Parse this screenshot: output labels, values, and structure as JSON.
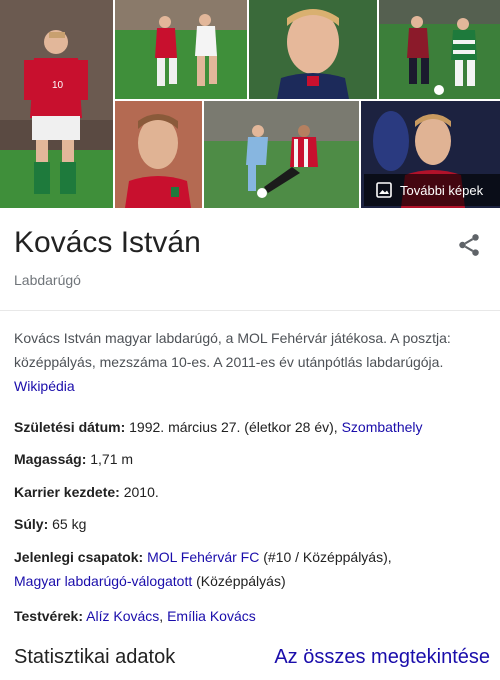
{
  "gallery": {
    "more_images_label": "További képek"
  },
  "header": {
    "title": "Kovács István",
    "subtitle": "Labdarúgó"
  },
  "description": {
    "text": "Kovács István magyar labdarúgó, a MOL Fehérvár játékosa. A posztja: középpályás, mezszáma 10-es. A 2011-es év utánpótlás labdarúgója.",
    "source_link": "Wikipédia"
  },
  "facts": {
    "birth": {
      "label": "Születési dátum:",
      "value": " 1992. március 27. (életkor 28 év), ",
      "place_link": "Szombathely"
    },
    "height": {
      "label": "Magasság:",
      "value": " 1,71 m"
    },
    "career_start": {
      "label": "Karrier kezdete:",
      "value": " 2010."
    },
    "weight": {
      "label": "Súly:",
      "value": " 65 kg"
    },
    "teams": {
      "label": "Jelenlegi csapatok:",
      "team1_link": "MOL Fehérvár FC",
      "team1_note": " (#10 / Középpályás),",
      "team2_link": "Magyar labdarúgó-válogatott",
      "team2_note": " (Középpályás)"
    },
    "siblings": {
      "label": "Testvérek:",
      "sibling1_link": "Alíz Kovács",
      "separator": ", ",
      "sibling2_link": "Emília Kovács"
    }
  },
  "footer": {
    "stats_label": "Statisztikai adatok",
    "see_all_label": "Az összes megtekintése"
  },
  "colors": {
    "link": "#1a0dab",
    "secondary_text": "#70757a",
    "jersey_red": "#c8102e",
    "jersey_green": "#1e7a3c",
    "pitch_green": "#3f8f3a"
  }
}
